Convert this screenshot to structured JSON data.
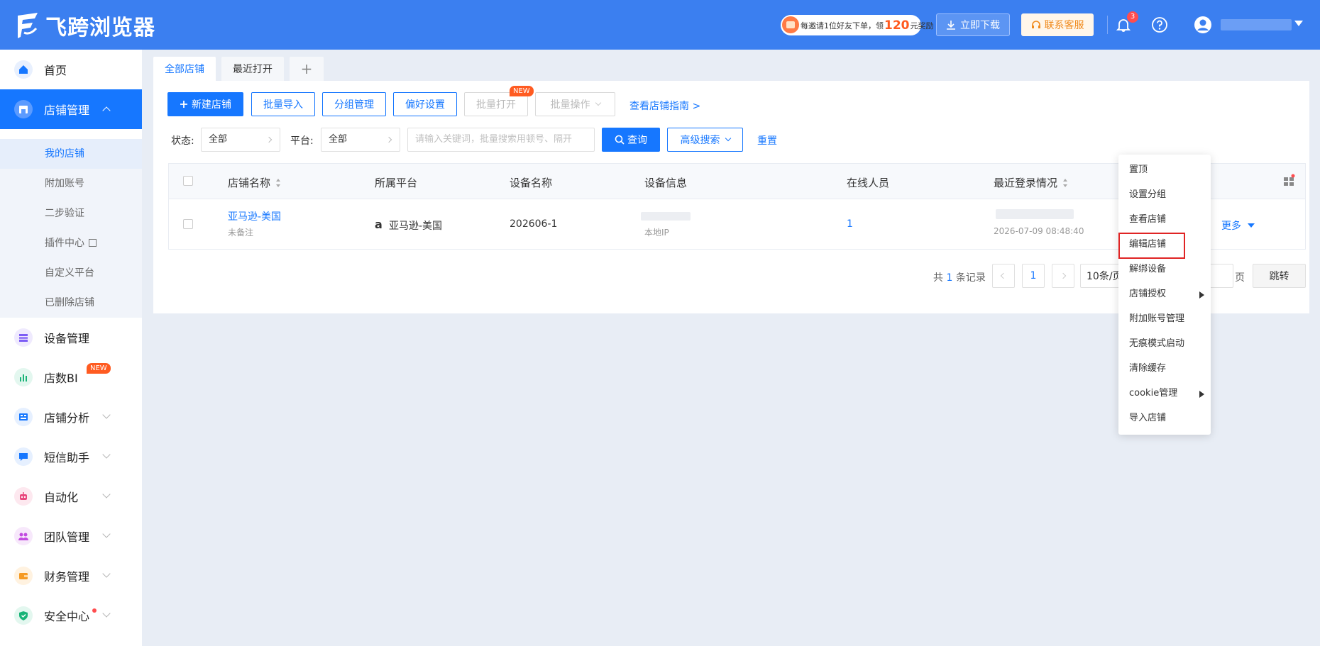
{
  "app": {
    "name": "飞跨浏览器"
  },
  "header": {
    "promo": {
      "text_before": "每邀请1位好友下单，领",
      "amount": "120",
      "text_after": "元奖励"
    },
    "download_label": "立即下载",
    "service_label": "联系客服",
    "notification_count": "3"
  },
  "sidebar": {
    "items": [
      {
        "label": "首页",
        "icon": "home-icon"
      },
      {
        "label": "店铺管理",
        "icon": "store-icon"
      },
      {
        "label": "设备管理",
        "icon": "device-icon"
      },
      {
        "label": "店数BI",
        "icon": "bi-chart-icon",
        "badge": "NEW"
      },
      {
        "label": "店铺分析",
        "icon": "analysis-icon"
      },
      {
        "label": "短信助手",
        "icon": "sms-icon"
      },
      {
        "label": "自动化",
        "icon": "robot-icon"
      },
      {
        "label": "团队管理",
        "icon": "team-icon"
      },
      {
        "label": "财务管理",
        "icon": "wallet-icon"
      },
      {
        "label": "安全中心",
        "icon": "shield-icon"
      }
    ],
    "sub_items": [
      "我的店铺",
      "附加账号",
      "二步验证",
      "插件中心",
      "自定义平台",
      "已删除店铺"
    ]
  },
  "tabs": {
    "all": "全部店铺",
    "recent": "最近打开",
    "add": "+"
  },
  "toolbar": {
    "new_store": "新建店铺",
    "batch_import": "批量导入",
    "group_manage": "分组管理",
    "preferences": "偏好设置",
    "batch_open": "批量打开",
    "batch_open_badge": "NEW",
    "batch_ops": "批量操作",
    "guide_link": "查看店铺指南 >"
  },
  "filters": {
    "status_label": "状态:",
    "status_value": "全部",
    "platform_label": "平台:",
    "platform_value": "全部",
    "search_placeholder": "请输入关键词，批量搜索用顿号、隔开",
    "query_label": "查询",
    "advanced_label": "高级搜索",
    "reset_label": "重置"
  },
  "table": {
    "headers": [
      "店铺名称",
      "所属平台",
      "设备名称",
      "设备信息",
      "在线人员",
      "最近登录情况"
    ],
    "rows": [
      {
        "store_name": "亚马逊-美国",
        "remark": "未备注",
        "platform": "亚马逊-美国",
        "device_name": "202606-1",
        "device_info_sub": "本地IP",
        "online": "1",
        "last_login_time": "2026-07-09 08:48:40",
        "more": "更多"
      }
    ]
  },
  "pagination": {
    "total_prefix": "共",
    "total": "1",
    "total_suffix": "条记录",
    "current_page": "1",
    "page_size": "10条/页",
    "page_unit": "页",
    "jump": "跳转"
  },
  "context_menu": {
    "items": [
      "置顶",
      "设置分组",
      "查看店铺",
      "编辑店铺",
      "解绑设备",
      "店铺授权",
      "附加账号管理",
      "无痕模式启动",
      "清除缓存",
      "cookie管理",
      "导入店铺"
    ],
    "highlighted": "编辑店铺"
  },
  "colors": {
    "brand": "#3b7ff0",
    "primary": "#1677ff",
    "highlight": "#e02424",
    "badge": "#ff5b21"
  }
}
